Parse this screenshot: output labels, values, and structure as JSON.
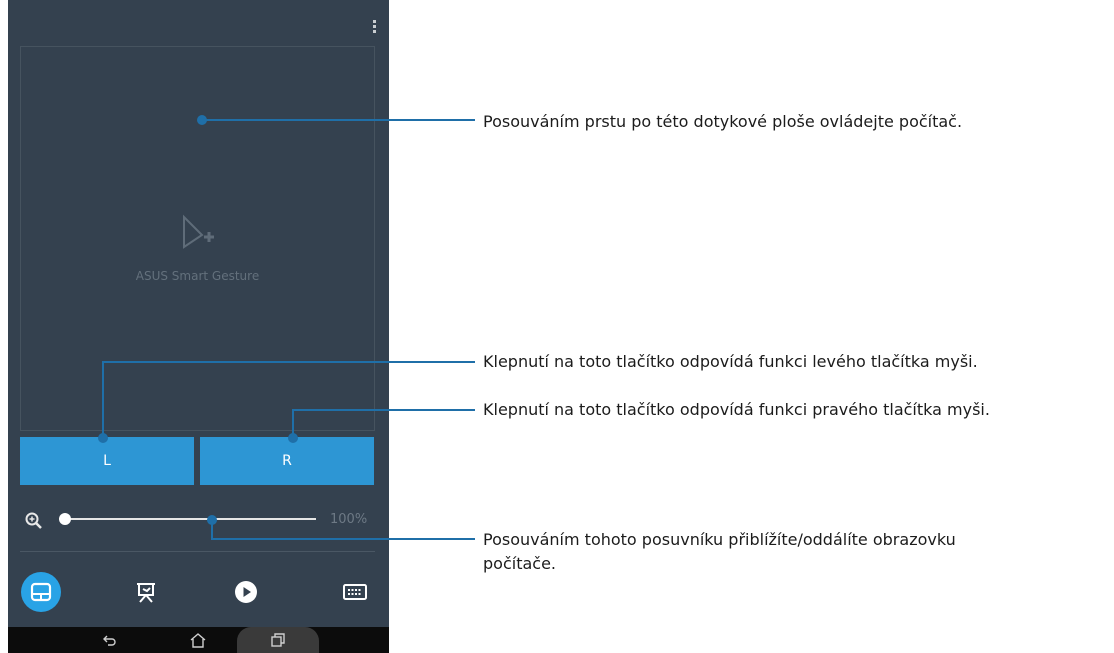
{
  "touchpad": {
    "app_name": "ASUS Smart Gesture"
  },
  "buttons": {
    "left": "L",
    "right": "R"
  },
  "zoom": {
    "value_text": "100%",
    "level": 0.0
  },
  "tabs": [
    {
      "name": "touchpad-tab",
      "icon": "touchpad-icon",
      "active": true
    },
    {
      "name": "presentation-tab",
      "icon": "presentation-icon",
      "active": false
    },
    {
      "name": "media-tab",
      "icon": "play-icon",
      "active": false
    },
    {
      "name": "keyboard-tab",
      "icon": "keyboard-icon",
      "active": false
    }
  ],
  "nav": {
    "back": "back-icon",
    "home": "home-icon",
    "recents": "recents-icon"
  },
  "callouts": {
    "touchpad": "Posouváním prstu po této dotykové ploše ovládejte počítač.",
    "left_button": "Klepnutí na toto tlačítko odpovídá funkci levého tlačítka myši.",
    "right_button": "Klepnutí na toto tlačítko odpovídá funkci pravého tlačítka myši.",
    "slider_line1": "Posouváním tohoto posuvníku přiblížíte/oddálíte obrazovku",
    "slider_line2": "počítače."
  },
  "colors": {
    "panel": "#34414f",
    "accent": "#2d96d4",
    "callout_line": "#1f6fa8",
    "nav_bar": "#0c0c0c"
  }
}
